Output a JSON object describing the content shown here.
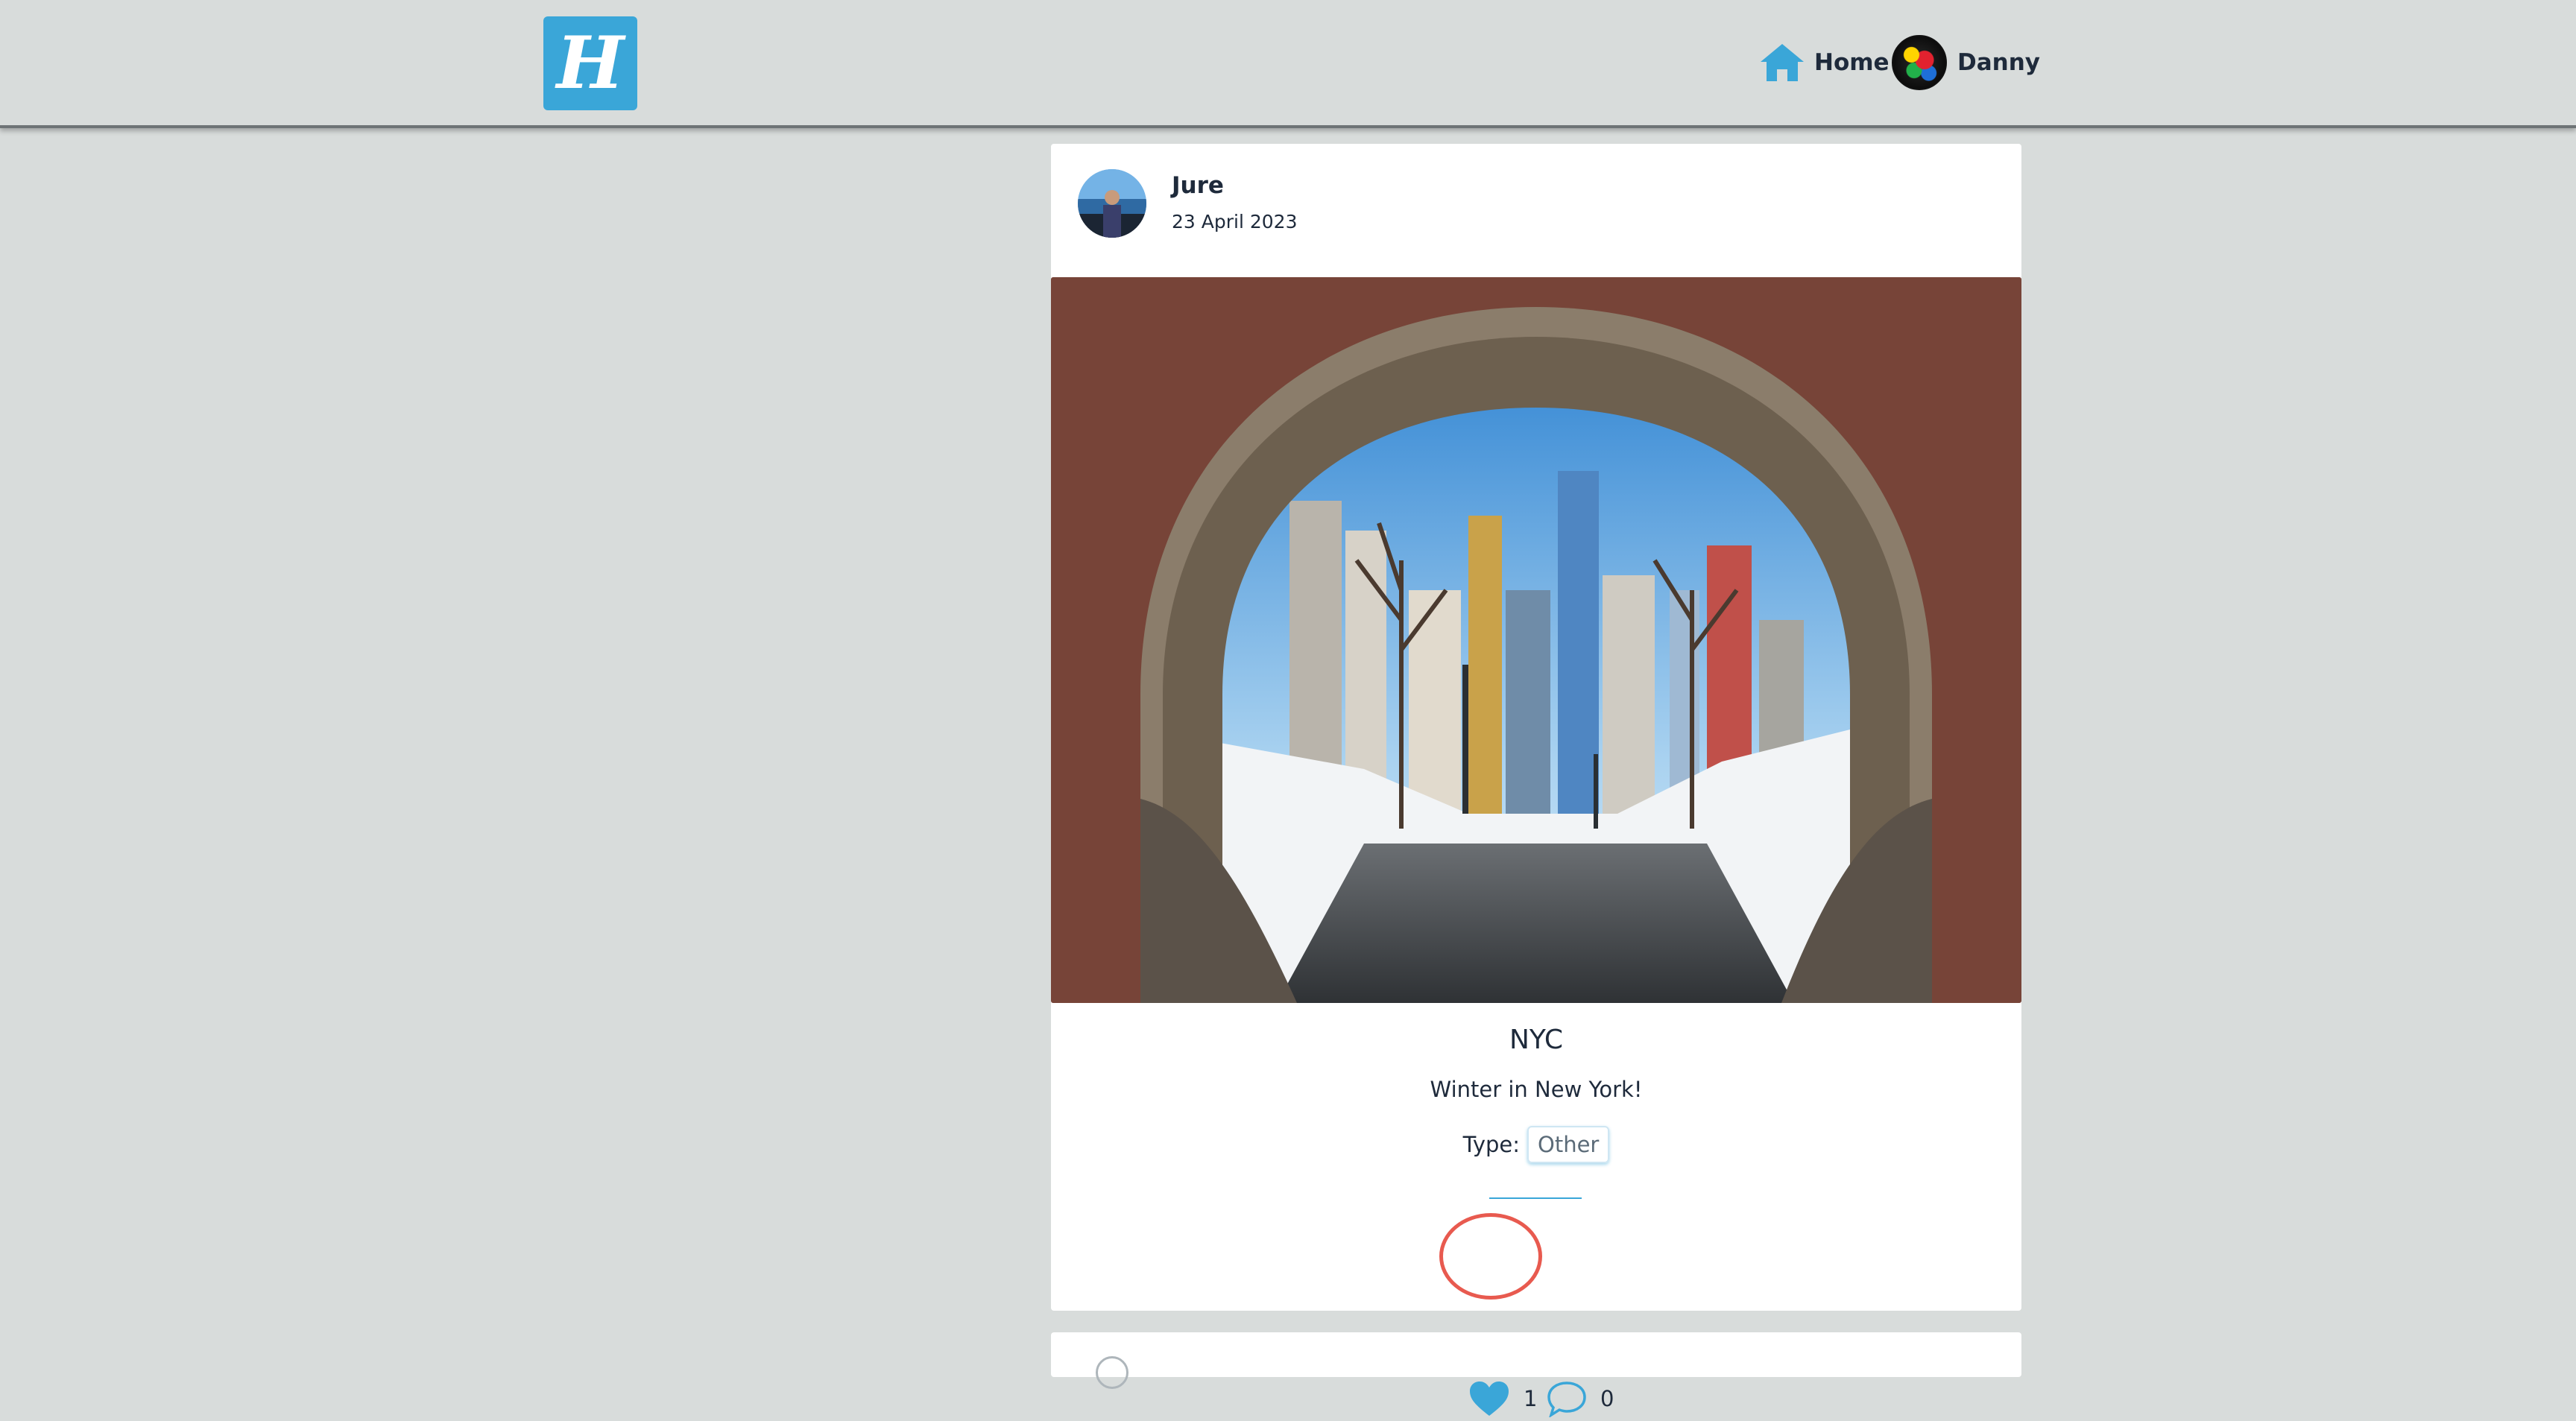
{
  "app": {
    "logo_letter": "H",
    "brand_color": "#3aa6d8"
  },
  "nav": {
    "home_label": "Home",
    "home_icon": "home-icon",
    "user_name": "Danny",
    "user_avatar_icon": "avatar"
  },
  "post": {
    "author_name": "Jure",
    "date": "23 April 2023",
    "title": "NYC",
    "description": "Winter in New York!",
    "type_label": "Type:",
    "type_value": "Other",
    "likes": "1",
    "comments": "0",
    "like_icon": "heart-icon",
    "comment_icon": "comment-icon"
  },
  "highlight_color": "#e85a4f"
}
